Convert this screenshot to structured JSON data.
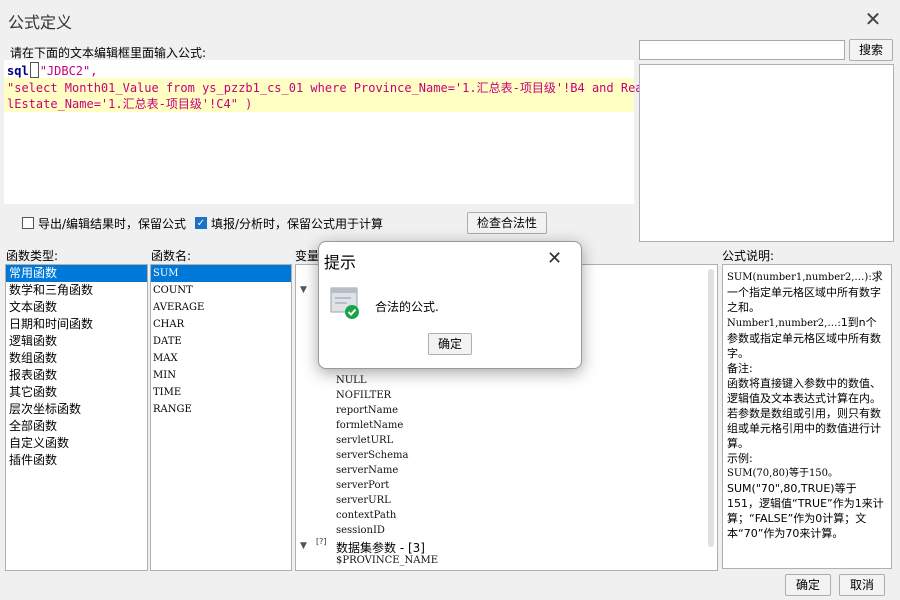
{
  "window": {
    "title": "公式定义"
  },
  "editor": {
    "prompt": "请在下面的文本编辑框里面输入公式:",
    "line1_kw": "sql",
    "line1_str": "\"JDBC2\",",
    "line2": "\"select Month01_Value from ys_pzzb1_cs_01 where Province_Name='1.汇总表-项目级'!B4 and Rea",
    "line3": "lEstate_Name='1.汇总表-项目级'!C4\" )"
  },
  "search": {
    "button_label": "搜索"
  },
  "options": {
    "export_label": "导出/编辑结果时，保留公式",
    "fill_label": "填报/分析时，保留公式用于计算",
    "check_button_label": "检查合法性"
  },
  "categories": {
    "header": "函数类型:",
    "items": [
      "常用函数",
      "数学和三角函数",
      "文本函数",
      "日期和时间函数",
      "逻辑函数",
      "数组函数",
      "报表函数",
      "其它函数",
      "层次坐标函数",
      "全部函数",
      "自定义函数",
      "插件函数"
    ]
  },
  "functions": {
    "header": "函数名:",
    "items": [
      "SUM",
      "COUNT",
      "AVERAGE",
      "CHAR",
      "DATE",
      "MAX",
      "MIN",
      "TIME",
      "RANGE"
    ]
  },
  "variables": {
    "header": "变量",
    "items": [
      "NULL",
      "NOFILTER",
      "reportName",
      "formletName",
      "servletURL",
      "serverSchema",
      "serverName",
      "serverPort",
      "serverURL",
      "contextPath",
      "sessionID"
    ],
    "dataset_group": "数据集参数 - [3]",
    "dataset_items": [
      "$PROVINCE_NAME"
    ]
  },
  "description": {
    "header": "公式说明:",
    "syntax": "SUM(number1,number2,…):",
    "syntax_text": "求一个指定单元格区域中所有数字之和。",
    "params": "Number1,number2,…:",
    "params_text": "1到n个参数或指定单元格区域中所有数字。",
    "note_title": "备注:",
    "note_text": "函数将直接键入参数中的数值、逻辑值及文本表达式计算在内。若参数是数组或引用，则只有数组或单元格引用中的数值进行计算。",
    "example_title": "示例:",
    "ex1": "SUM(70,80)等于150。",
    "ex2": "SUM(\"70\",80,TRUE)等于151，逻辑值“TRUE”作为1来计算；“FALSE”作为0计算；文本“70”作为70来计算。"
  },
  "footer": {
    "ok_label": "确定",
    "cancel_label": "取消"
  },
  "dialog": {
    "title": "提示",
    "message": "合法的公式.",
    "ok_label": "确定"
  },
  "colors": {
    "selection": "#0078d7",
    "keyword": "#000080",
    "string": "#c8007a",
    "highlight": "#ffffc4"
  }
}
